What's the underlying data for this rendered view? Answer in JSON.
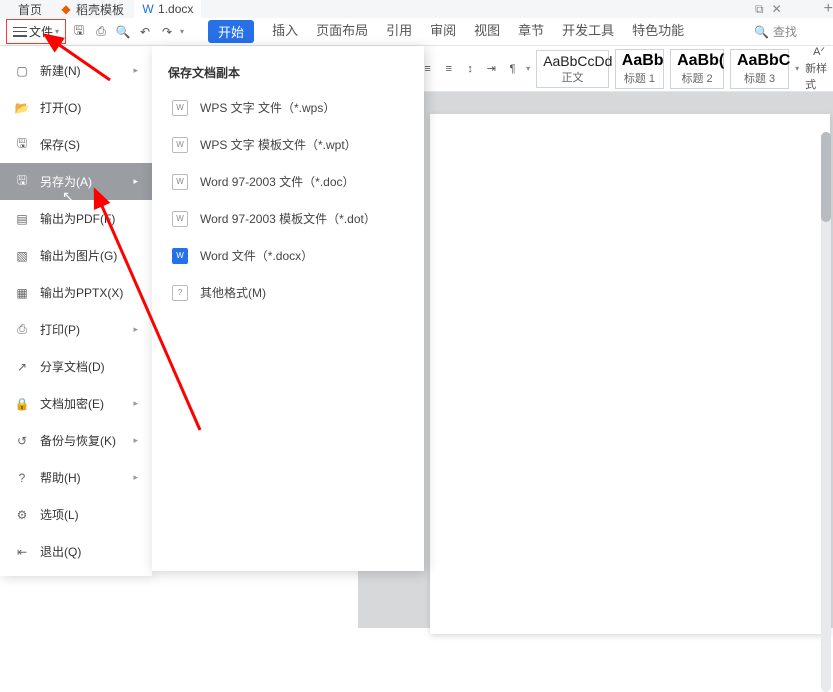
{
  "tabs": {
    "home_label": "首页",
    "template_label": "稻壳模板",
    "doc_label": "1.docx",
    "window_icon": "⧉",
    "close_icon": "✕",
    "plus": "+"
  },
  "toolbar": {
    "file_label": "文件",
    "menu": {
      "start": "开始",
      "insert": "插入",
      "page_layout": "页面布局",
      "reference": "引用",
      "review": "审阅",
      "view": "视图",
      "chapter": "章节",
      "dev_tools": "开发工具",
      "special": "特色功能"
    },
    "search_icon": "🔍",
    "search_label": "查找"
  },
  "styles": {
    "s1_preview": "AaBbCcDd",
    "s1_label": "正文",
    "s2_preview": "AaBb",
    "s2_label": "标题 1",
    "s3_preview": "AaBb(",
    "s3_label": "标题 2",
    "s4_preview": "AaBbC",
    "s4_label": "标题 3",
    "newstyle_label": "新样式"
  },
  "file_menu": {
    "items": [
      {
        "label": "新建(N)",
        "has_sub": true
      },
      {
        "label": "打开(O)",
        "has_sub": false
      },
      {
        "label": "保存(S)",
        "has_sub": false
      },
      {
        "label": "另存为(A)",
        "has_sub": true
      },
      {
        "label": "输出为PDF(F)",
        "has_sub": false
      },
      {
        "label": "输出为图片(G)",
        "has_sub": false
      },
      {
        "label": "输出为PPTX(X)",
        "has_sub": false
      },
      {
        "label": "打印(P)",
        "has_sub": true
      },
      {
        "label": "分享文档(D)",
        "has_sub": false
      },
      {
        "label": "文档加密(E)",
        "has_sub": true
      },
      {
        "label": "备份与恢复(K)",
        "has_sub": true
      },
      {
        "label": "帮助(H)",
        "has_sub": true
      },
      {
        "label": "选项(L)",
        "has_sub": false
      },
      {
        "label": "退出(Q)",
        "has_sub": false
      }
    ]
  },
  "submenu": {
    "title": "保存文档副本",
    "items": [
      {
        "label": "WPS 文字 文件（*.wps）",
        "type": "wps"
      },
      {
        "label": "WPS 文字 模板文件（*.wpt）",
        "type": "wpt"
      },
      {
        "label": "Word 97-2003 文件（*.doc）",
        "type": "doc"
      },
      {
        "label": "Word 97-2003 模板文件（*.dot）",
        "type": "dot"
      },
      {
        "label": "Word 文件（*.docx）",
        "type": "docx"
      },
      {
        "label": "其他格式(M)",
        "type": "other"
      }
    ]
  },
  "annotation": {
    "arrow_color": "#ff0000"
  }
}
